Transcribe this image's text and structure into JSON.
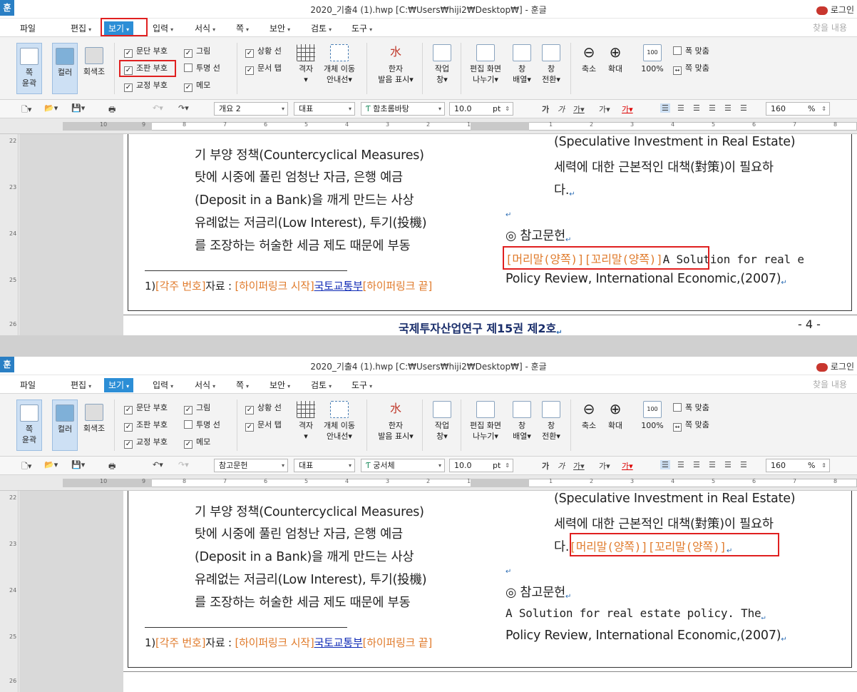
{
  "window": {
    "app_icon": "훈",
    "title": "2020_기출4 (1).hwp [C:₩Users₩hiji2₩Desktop₩] - 훈글",
    "login": "로그인"
  },
  "menus": [
    "파일",
    "편집",
    "보기",
    "입력",
    "서식",
    "쪽",
    "보안",
    "검토",
    "도구"
  ],
  "find_label": "찾을 내용",
  "ribbon": {
    "view_mode": {
      "label1": "쪽",
      "label2": "윤곽"
    },
    "color": "컬러",
    "gray": "회색조",
    "check_col1": [
      "문단 부호",
      "조판 부호",
      "교정 부호"
    ],
    "check_col2": [
      "그림",
      "투명 선",
      "메모"
    ],
    "check_col3": [
      "상황 선",
      "문서 탭"
    ],
    "grid": "격자",
    "object_move": {
      "l1": "개체 이동",
      "l2": "안내선"
    },
    "hanja": {
      "l1": "한자",
      "l2": "발음 표시"
    },
    "task": {
      "l1": "작업",
      "l2": "창"
    },
    "split": {
      "l1": "편집 화면",
      "l2": "나누기"
    },
    "arrange": {
      "l1": "창",
      "l2": "배열"
    },
    "switch": {
      "l1": "창",
      "l2": "전환"
    },
    "zoom_out": "축소",
    "zoom_in": "확대",
    "zoom100": "100%",
    "fit_width": "폭 맞춤",
    "fit_page": "쪽 맞춤"
  },
  "toolbar": {
    "style1": "개요 2",
    "style2": "참고문헌",
    "lang": "대표",
    "font1": "함초롬바탕",
    "font2": "궁서체",
    "size": "10.0",
    "unit": "pt",
    "zoom": "160",
    "pct": "%"
  },
  "ruler_numbers": [
    "10",
    "9",
    "8",
    "7",
    "6",
    "5",
    "4",
    "3",
    "2",
    "1",
    "1",
    "2",
    "3",
    "4",
    "5",
    "6",
    "7",
    "8"
  ],
  "vruler_numbers": [
    "22",
    "23",
    "24",
    "25",
    "26"
  ],
  "doc": {
    "left_col": [
      "기 부양 정책(Countercyclical Measures)",
      "탓에 시중에 풀린 엄청난 자금, 은행 예금",
      "(Deposit in a Bank)을 깨게 만드는 사상",
      "유례없는 저금리(Low Interest), 투기(投機)",
      "를 조장하는 허술한 세금 제도 때문에 부동"
    ],
    "right_col": [
      "(Speculative Investment in Real Estate)",
      "세력에 대한 근본적인 대책(對策)이 필요하",
      "다."
    ],
    "ref_title": "◎ 참고문헌",
    "header_code": "[머리말(양쪽)][꼬리말(양쪽)]",
    "ref_line1_a": "A Solution for real e",
    "ref_line1_b": "A Solution for real estate policy. The",
    "ref_line2": "Policy Review, International Economic,(2007)",
    "footnote_num": "1)",
    "fn_code1": "[각주 번호]",
    "fn_text": "자료 : ",
    "fn_code2": "[하이퍼링크 시작]",
    "fn_link": "국토교통부",
    "fn_code3": "[하이퍼링크 끝]",
    "footer": "국제투자산업연구 제15권 제2호",
    "page_num": "- 4 -"
  },
  "colors": {
    "accent": "#2c8ed6",
    "highlight": "#e02020",
    "code": "#e07b2c",
    "link": "#0f2ab5"
  }
}
